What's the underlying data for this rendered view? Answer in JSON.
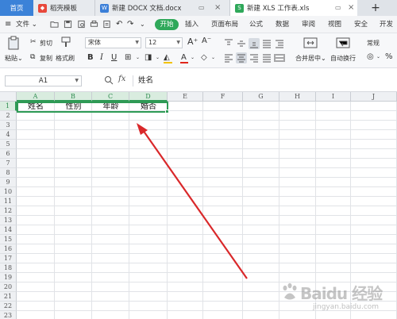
{
  "tabs": {
    "home": "首页",
    "tab1": "稻壳模板",
    "tab2": "新建 DOCX 文档.docx",
    "tab3": "新建 XLS 工作表.xls",
    "new_tab": "+"
  },
  "menu": {
    "file": "文件",
    "start": "开始",
    "insert": "插入",
    "layout": "页面布局",
    "formula": "公式",
    "data": "数据",
    "review": "审阅",
    "view": "视图",
    "security": "安全",
    "developer": "开发工"
  },
  "ribbon": {
    "paste": "粘贴",
    "cut": "剪切",
    "copy": "复制",
    "format_painter": "格式刷",
    "font_name": "宋体",
    "font_size": "12",
    "merge_center": "合并居中",
    "auto_wrap": "自动换行",
    "number_format": "常规",
    "percent": "%"
  },
  "formula_bar": {
    "name_box": "A1",
    "fx": "fx",
    "content": "姓名"
  },
  "grid": {
    "columns": [
      "A",
      "B",
      "C",
      "D",
      "E",
      "F",
      "G",
      "H",
      "I",
      "J"
    ],
    "rows": [
      "1",
      "2",
      "3",
      "4",
      "5",
      "6",
      "7",
      "8",
      "9",
      "10",
      "11",
      "12",
      "13",
      "14",
      "15",
      "16",
      "17",
      "18",
      "19",
      "20",
      "21",
      "22",
      "23"
    ],
    "row1": [
      "姓名",
      "性别",
      "年龄",
      "婚否"
    ]
  },
  "watermark": {
    "brand": "Baidu 经验",
    "url": "jingyan.baidu.com"
  },
  "colors": {
    "accent_green": "#2e9a55",
    "home_tab": "#3b82d8",
    "arrow": "#d9282a"
  }
}
